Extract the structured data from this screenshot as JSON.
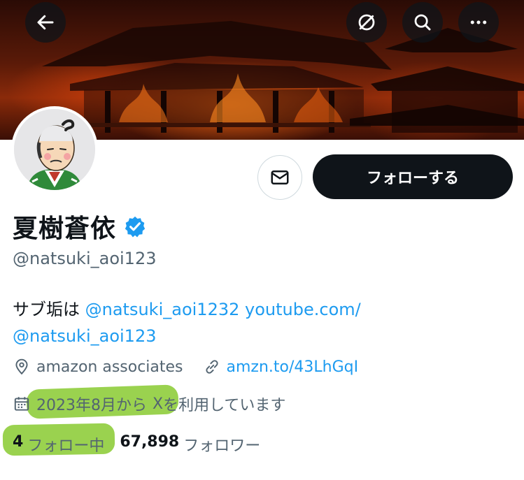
{
  "header": {
    "back_icon": "arrow-left-icon",
    "icons": [
      "no-translate-icon",
      "search-icon",
      "more-icon"
    ]
  },
  "profile": {
    "display_name": "夏樹蒼依",
    "handle": "@natsuki_aoi123",
    "verified": true,
    "follow_label": "フォローする",
    "bio": {
      "text_prefix": "サブ垢は ",
      "mention": "@natsuki_aoi1232",
      "url": "youtube.com/",
      "url_line2": "@natsuki_aoi123"
    },
    "location": "amazon associates",
    "website": "amzn.to/43LhGqI",
    "joined_highlight": "2023年8月から",
    "joined_x": "X",
    "joined_rest": "を利用しています",
    "following_count": "4",
    "following_label": "フォロー中",
    "followers_count": "67,898",
    "followers_label": "フォロワー"
  },
  "colors": {
    "accent": "#1d9bf0",
    "text": "#0f1419",
    "secondary": "#536471",
    "highlight": "#78c314"
  }
}
